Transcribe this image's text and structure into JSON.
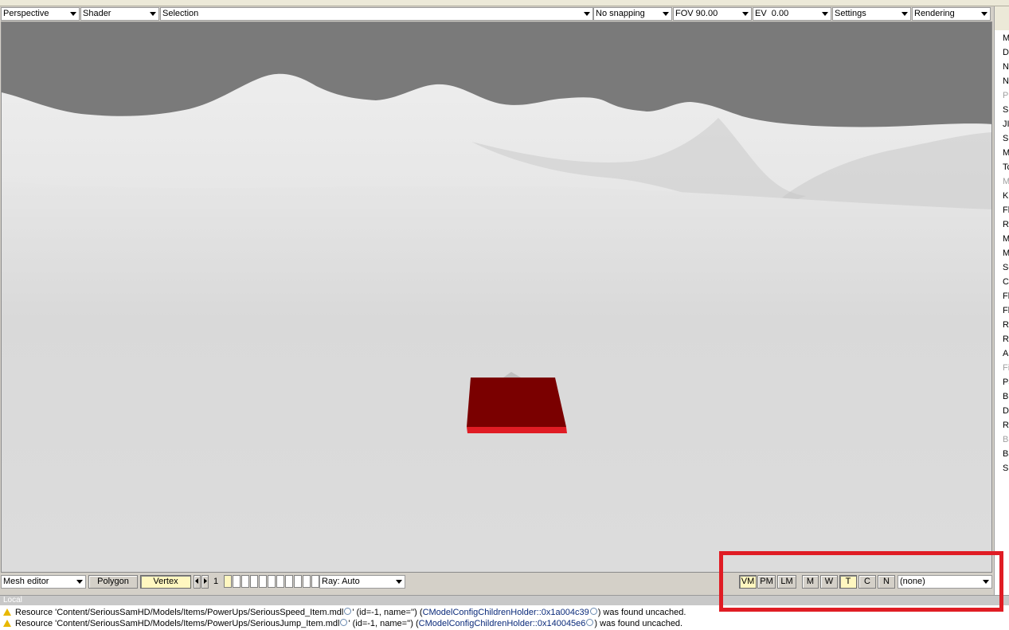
{
  "toolbar": {
    "view_mode": "Perspective",
    "shader": "Shader",
    "selection": "Selection",
    "snapping": "No snapping",
    "fov": "FOV 90.00",
    "ev": "EV  0.00",
    "settings": "Settings",
    "rendering": "Rendering"
  },
  "right_panel": {
    "items": [
      {
        "label": "M",
        "disabled": false
      },
      {
        "label": "Di",
        "disabled": false
      },
      {
        "label": "N",
        "disabled": false
      },
      {
        "label": "N",
        "disabled": false
      },
      {
        "label": "Pl",
        "disabled": true
      },
      {
        "label": "Sp",
        "disabled": false
      },
      {
        "label": "JI",
        "disabled": false
      },
      {
        "label": "Sr",
        "disabled": false
      },
      {
        "label": "M",
        "disabled": false
      },
      {
        "label": "Tc",
        "disabled": false
      },
      {
        "label": "M",
        "disabled": true
      },
      {
        "label": "Ki",
        "disabled": false
      },
      {
        "label": "Fl",
        "disabled": false
      },
      {
        "label": "Re",
        "disabled": false
      },
      {
        "label": "M",
        "disabled": false
      },
      {
        "label": "M",
        "disabled": false
      },
      {
        "label": "Se",
        "disabled": false
      },
      {
        "label": "Cc",
        "disabled": false
      },
      {
        "label": "Fl",
        "disabled": false
      },
      {
        "label": "Fl",
        "disabled": false
      },
      {
        "label": "Re",
        "disabled": false
      },
      {
        "label": "Re",
        "disabled": false
      },
      {
        "label": "Al",
        "disabled": false
      },
      {
        "label": "Fi",
        "disabled": true
      },
      {
        "label": "Pa",
        "disabled": false
      },
      {
        "label": "Br",
        "disabled": false
      },
      {
        "label": "De",
        "disabled": false
      },
      {
        "label": "Re",
        "disabled": false
      },
      {
        "label": "Ba",
        "disabled": true
      },
      {
        "label": "Ba",
        "disabled": false
      },
      {
        "label": "Sr",
        "disabled": false
      }
    ]
  },
  "bottom_bar": {
    "editor_mode": "Mesh editor",
    "polygon": "Polygon",
    "vertex": "Vertex",
    "slot_number": "1",
    "ray": "Ray: Auto",
    "toggles": [
      {
        "label": "VM",
        "active": true
      },
      {
        "label": "PM",
        "active": false
      },
      {
        "label": "LM",
        "active": false
      },
      {
        "label": "M",
        "active": false
      },
      {
        "label": "W",
        "active": false
      },
      {
        "label": "T",
        "active": true
      },
      {
        "label": "C",
        "active": false
      },
      {
        "label": "N",
        "active": false
      }
    ],
    "layer_select": "(none)"
  },
  "log": {
    "header": "Local",
    "lines": [
      {
        "prefix": "Resource 'Content/SeriousSamHD/Models/Items/PowerUps/SeriousSpeed_Item.mdl",
        "mid": "' (id=-1, name='') (",
        "holder": "CModelConfigChildrenHolder::0x1a004c39",
        "suffix": ") was found uncached."
      },
      {
        "prefix": "Resource 'Content/SeriousSamHD/Models/Items/PowerUps/SeriousJump_Item.mdl",
        "mid": "' (id=-1, name='') (",
        "holder": "CModelConfigChildrenHolder::0x140045e6",
        "suffix": ") was found uncached."
      }
    ]
  },
  "colors": {
    "sky": "#7a7a7a",
    "terrain": "#d8d8d8",
    "object_top": "#7a0000",
    "object_edge": "#e01c24",
    "highlight_box": "#e01c24",
    "toggle_active": "#fff7c0"
  }
}
